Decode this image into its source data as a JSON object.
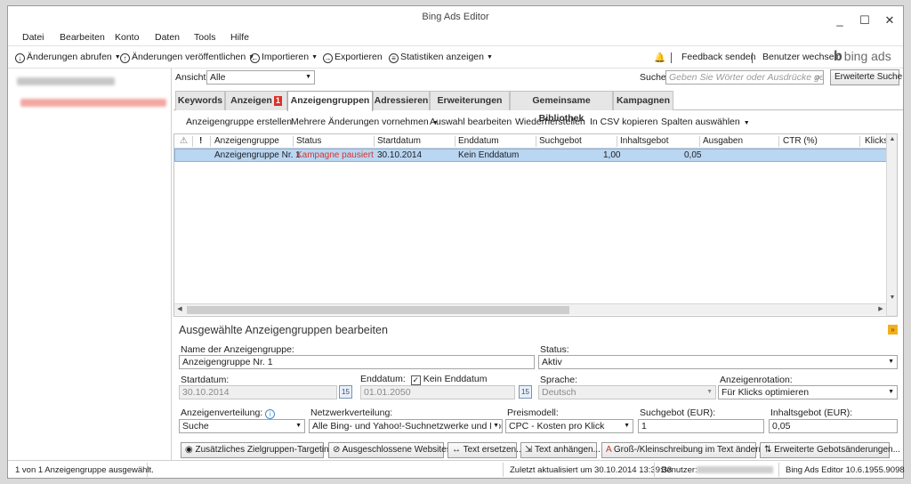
{
  "window": {
    "title": "Bing Ads Editor",
    "controls": [
      "_",
      "☐",
      "✕"
    ]
  },
  "menu": [
    "Datei",
    "Bearbeiten",
    "Konto",
    "Daten",
    "Tools",
    "Hilfe"
  ],
  "toolbar": {
    "get_changes": "Änderungen abrufen",
    "publish_changes": "Änderungen veröffentlichen",
    "import": "Importieren",
    "export": "Exportieren",
    "show_stats": "Statistiken anzeigen",
    "feedback": "Feedback senden",
    "switch_user": "Benutzer wechseln",
    "brand": "bing ads"
  },
  "view": {
    "label": "Ansicht",
    "value": "Alle"
  },
  "search": {
    "label": "Suche",
    "placeholder": "Geben Sie Wörter oder Ausdrücke getre",
    "advanced": "Erweiterte Suche"
  },
  "tabs": [
    {
      "label": "Keywords"
    },
    {
      "label": "Anzeigen",
      "badge": "1"
    },
    {
      "label": "Anzeigengruppen"
    },
    {
      "label": "Adressieren"
    },
    {
      "label": "Erweiterungen"
    },
    {
      "label": "Gemeinsame Bibliothek"
    },
    {
      "label": "Kampagnen"
    }
  ],
  "actions": {
    "create": "Anzeigengruppe erstellen",
    "multi_edit": "Mehrere Änderungen vornehmen",
    "edit_selection": "Auswahl bearbeiten",
    "restore": "Wiederherstellen",
    "copy_csv": "In CSV kopieren",
    "select_columns": "Spalten auswählen"
  },
  "grid": {
    "columns": [
      "Anzeigengruppe",
      "Status",
      "Startdatum",
      "Enddatum",
      "Suchgebot",
      "Inhaltsgebot",
      "Ausgaben",
      "CTR (%)",
      "Klicks"
    ],
    "rows": [
      {
        "name": "Anzeigengruppe Nr. 1",
        "status": "Kampagne pausiert",
        "start": "30.10.2014",
        "end": "Kein Enddatum",
        "search_bid": "1,00",
        "content_bid": "0,05"
      }
    ]
  },
  "edit": {
    "title": "Ausgewählte Anzeigengruppen bearbeiten",
    "name_label": "Name der Anzeigengruppe:",
    "name_value": "Anzeigengruppe Nr. 1",
    "status_label": "Status:",
    "status_value": "Aktiv",
    "start_label": "Startdatum:",
    "start_value": "30.10.2014",
    "end_label": "Enddatum:",
    "no_end_label": "Kein Enddatum",
    "end_value": "01.01.2050",
    "calendar_day": "15",
    "language_label": "Sprache:",
    "language_value": "Deutsch",
    "rotation_label": "Anzeigenrotation:",
    "rotation_value": "Für Klicks optimieren",
    "distribution_label": "Anzeigenverteilung:",
    "distribution_value": "Suche",
    "network_label": "Netzwerkverteilung:",
    "network_value": "Alle Bing- und Yahoo!-Suchnetzwerke und Konsorti",
    "pricing_label": "Preismodell:",
    "pricing_value": "CPC - Kosten pro Klick",
    "search_bid_label": "Suchgebot (EUR):",
    "search_bid_value": "1",
    "content_bid_label": "Inhaltsgebot (EUR):",
    "content_bid_value": "0,05"
  },
  "bottom_buttons": {
    "targeting": "Zusätzliches Zielgruppen-Targeting...",
    "excluded": "Ausgeschlossene Websites...",
    "replace": "Text ersetzen...",
    "append": "Text anhängen...",
    "case": "Groß-/Kleinschreibung im Text ändern...",
    "bids": "Erweiterte Gebotsänderungen..."
  },
  "status": {
    "selection": "1 von 1 Anzeigengruppe ausgewählt.",
    "updated": "Zuletzt aktualisiert um 30.10.2014 13:39:33",
    "user_label": "Benutzer:",
    "version": "Bing Ads Editor 10.6.1955.9098"
  }
}
